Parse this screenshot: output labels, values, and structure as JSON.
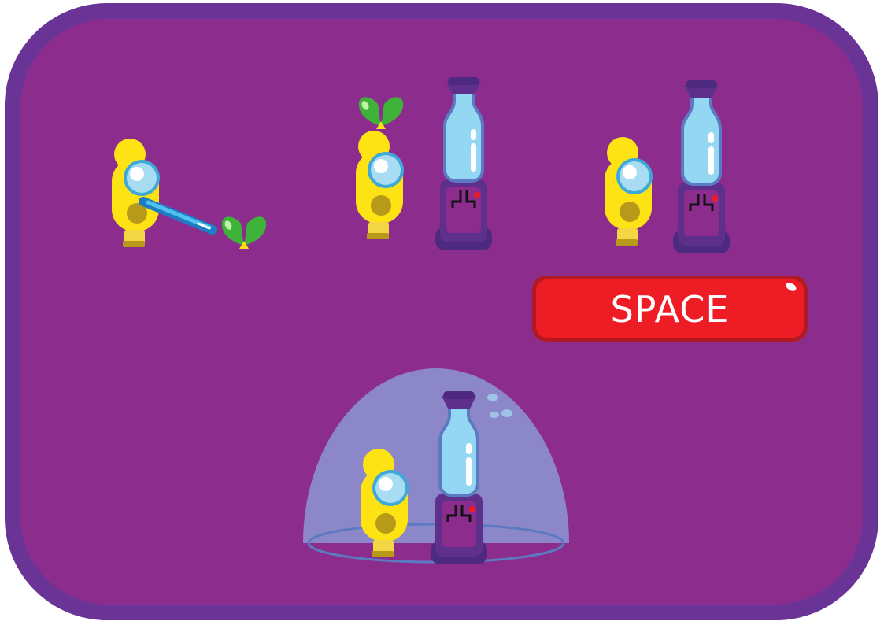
{
  "controls": {
    "action_key": "SPACE"
  },
  "palette": {
    "frame": "#6a3496",
    "background": "#8c2d8e",
    "character": "#fde214",
    "plant": "#3fb23a",
    "bottle": "#94d7f3",
    "button": "#ee1d25"
  },
  "icons": {
    "step1": [
      "character-icon",
      "watering-wand-icon",
      "plant-sprout-icon"
    ],
    "step2": [
      "character-icon",
      "plant-sprout-icon",
      "water-machine-icon"
    ],
    "step3": [
      "character-icon",
      "water-machine-icon",
      "space-key-icon"
    ],
    "step4": [
      "character-icon",
      "water-machine-icon",
      "bubble-dome-icon"
    ]
  }
}
